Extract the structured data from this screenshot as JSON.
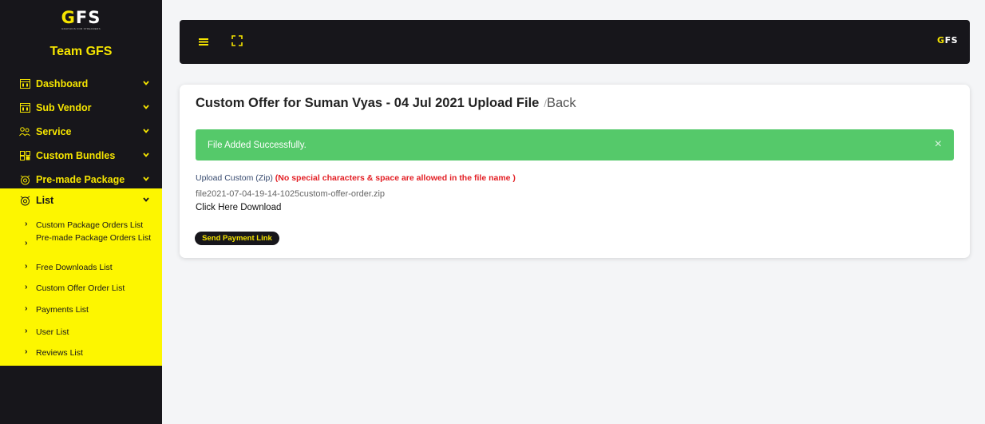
{
  "brand": {
    "logo_prefix": "G",
    "logo_rest": "FS",
    "logo_sub": "GRAPHICS FOR STREAMERS",
    "team_name": "Team GFS",
    "accent_color": "#f5e400",
    "dark_color": "#17161b"
  },
  "sidebar": {
    "items": [
      {
        "label": "Dashboard",
        "icon": "dashboard-icon"
      },
      {
        "label": "Sub Vendor",
        "icon": "vendor-icon"
      },
      {
        "label": "Service",
        "icon": "service-icon"
      },
      {
        "label": "Custom Bundles",
        "icon": "bundles-icon"
      },
      {
        "label": "Pre-made Package",
        "icon": "package-icon"
      }
    ],
    "active": {
      "label": "List",
      "icon": "list-icon",
      "subitems": [
        "Custom Package Orders List",
        "Pre-made Package Orders List",
        "Free Downloads List",
        "Custom Offer Order List",
        "Payments List",
        "User List",
        "Reviews List"
      ]
    }
  },
  "topbar": {
    "logo_prefix": "G",
    "logo_rest": "FS"
  },
  "main": {
    "title": "Custom Offer for Suman Vyas - 04 Jul 2021 Upload File",
    "separator": "/",
    "back_label": "Back",
    "alert": {
      "message": "File Added Successfully.",
      "close": "×",
      "color": "#55c96a"
    },
    "upload_label": "Upload Custom (Zip)",
    "upload_warning": "(No special characters & space are allowed in the file name )",
    "file_name": "file2021-07-04-19-14-1025custom-offer-order.zip",
    "download_link": "Click Here Download",
    "send_button": "Send Payment Link"
  }
}
